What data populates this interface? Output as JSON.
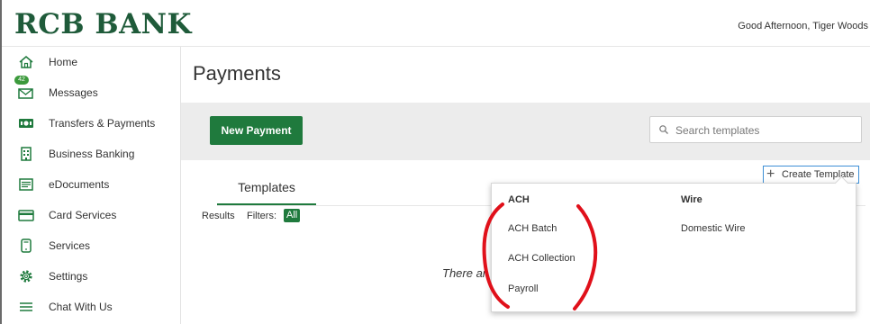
{
  "header": {
    "logo_text": "RCB BANK",
    "greeting": "Good Afternoon, Tiger Woods"
  },
  "sidebar": {
    "items": [
      {
        "label": "Home",
        "icon": "home-icon"
      },
      {
        "label": "Messages",
        "icon": "envelope-icon",
        "badge": "42"
      },
      {
        "label": "Transfers & Payments",
        "icon": "money-icon"
      },
      {
        "label": "Business Banking",
        "icon": "building-icon"
      },
      {
        "label": "eDocuments",
        "icon": "document-icon"
      },
      {
        "label": "Card Services",
        "icon": "credit-card-icon"
      },
      {
        "label": "Services",
        "icon": "phone-icon"
      },
      {
        "label": "Settings",
        "icon": "gear-icon"
      },
      {
        "label": "Chat With Us",
        "icon": "menu-lines-icon"
      }
    ]
  },
  "main": {
    "title": "Payments",
    "new_payment_label": "New Payment",
    "search_placeholder": "Search templates",
    "create_template_label": "Create Template",
    "tab_label": "Templates",
    "results_label": "Results",
    "filters_label": "Filters:",
    "filter_chip": "All",
    "empty_text": "There ar"
  },
  "dropdown": {
    "columns": [
      {
        "header": "ACH",
        "items": [
          "ACH Batch",
          "ACH Collection",
          "Payroll"
        ]
      },
      {
        "header": "Wire",
        "items": [
          "Domestic Wire"
        ]
      }
    ]
  },
  "colors": {
    "brand_green": "#1f7a3d",
    "logo_green": "#1f5b3a",
    "annotation_red": "#e0101a",
    "focus_blue": "#3d8fd6"
  }
}
